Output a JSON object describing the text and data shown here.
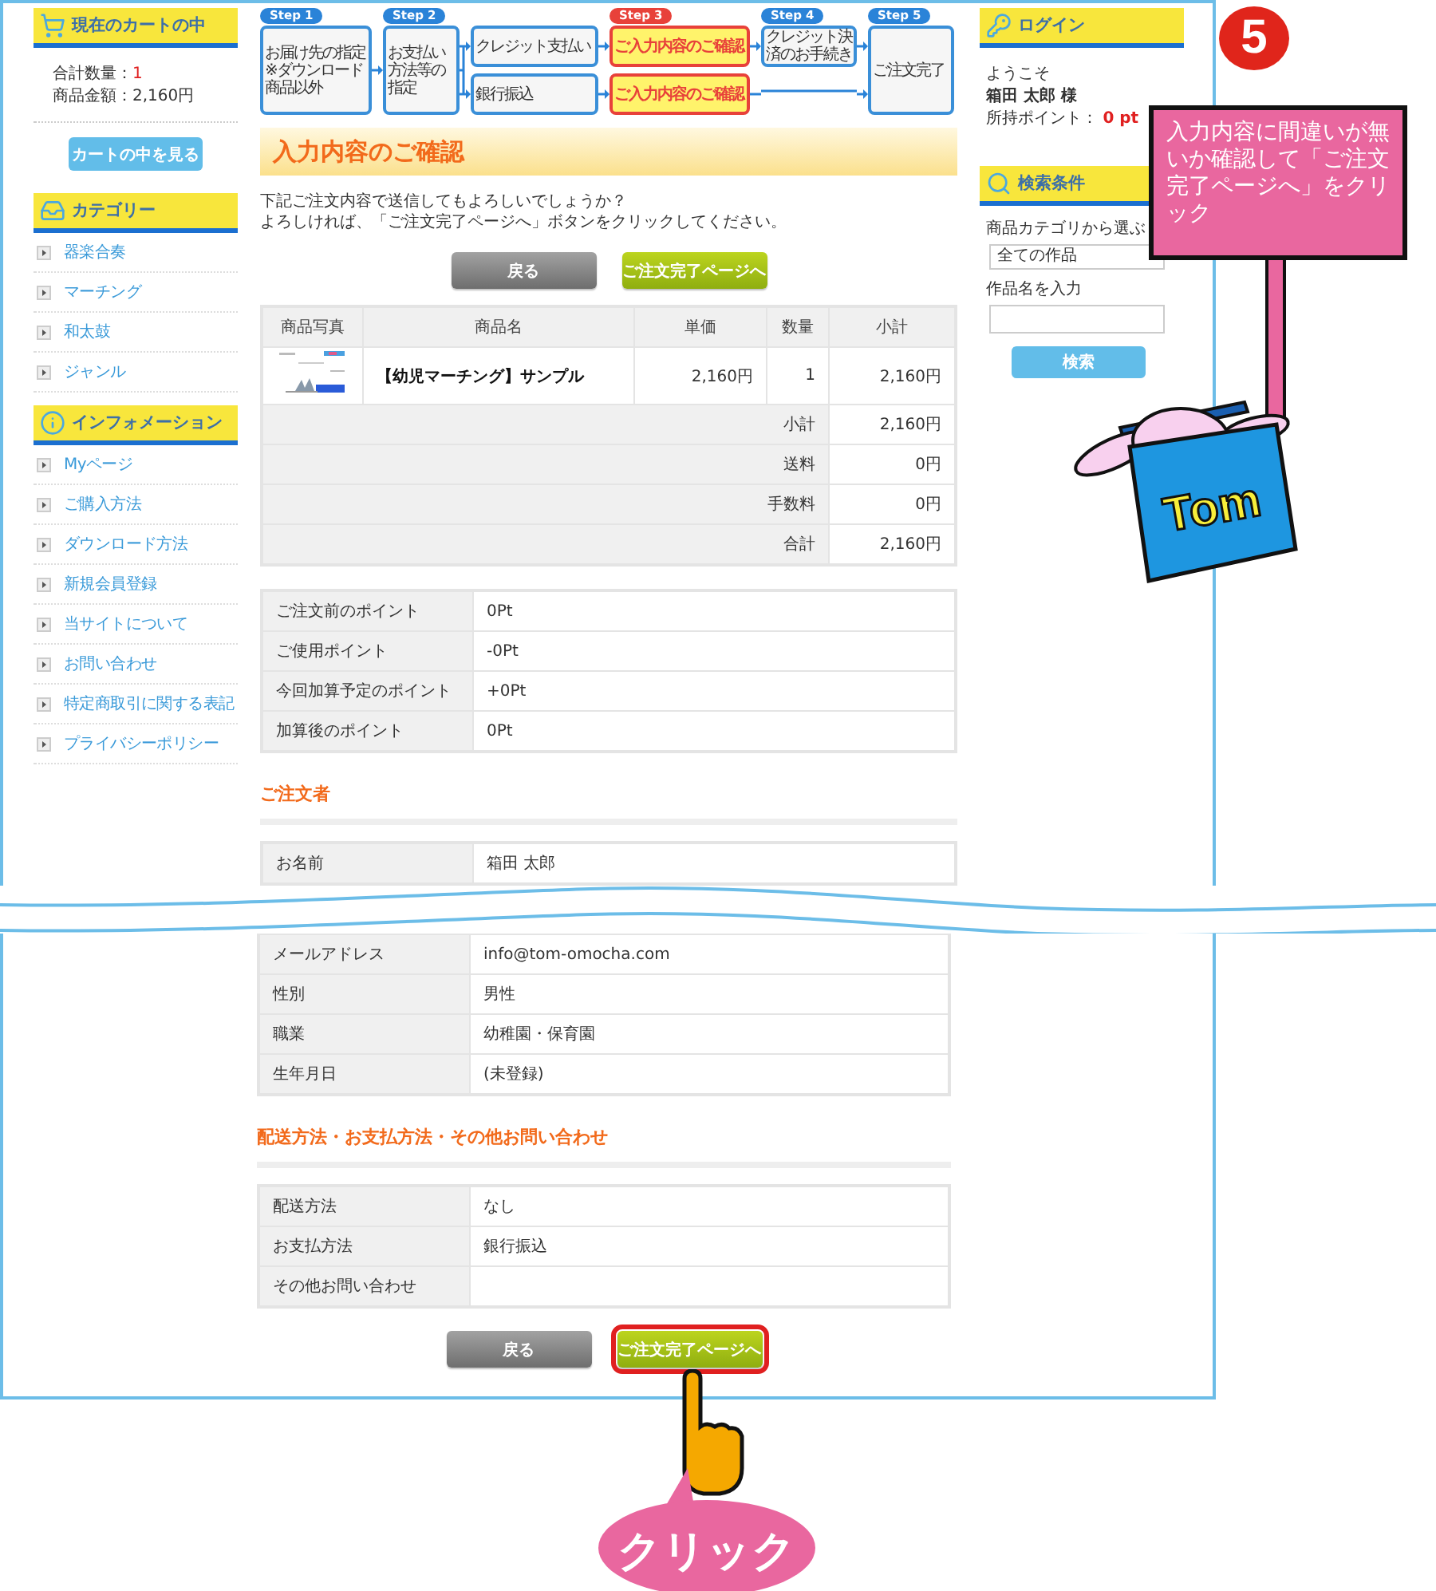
{
  "cart": {
    "title": "現在のカートの中",
    "lines": [
      {
        "label": "合計数量：",
        "value": "1",
        "emphasis": true
      },
      {
        "label": "商品金額：",
        "value": "2,160円",
        "emphasis": false
      }
    ],
    "button": "カートの中を見る"
  },
  "categories": {
    "title": "カテゴリー",
    "items": [
      "器楽合奏",
      "マーチング",
      "和太鼓",
      "ジャンル"
    ]
  },
  "information": {
    "title": "インフォメーション",
    "items": [
      "Myページ",
      "ご購入方法",
      "ダウンロード方法",
      "新規会員登録",
      "当サイトについて",
      "お問い合わせ",
      "特定商取引に関する表記",
      "プライバシーポリシー"
    ]
  },
  "steps": [
    {
      "label": "Step 1",
      "selected": false,
      "bypass": false,
      "options": [
        {
          "text": "お届け先の指定",
          "note": "※ダウンロード商品以外"
        }
      ]
    },
    {
      "label": "Step 2",
      "selected": false,
      "bypass": false,
      "options": [
        {
          "text": "お支払い方法等の指定"
        }
      ]
    },
    {
      "selected": false,
      "bypass": false,
      "options": [
        {
          "text": "クレジット支払い"
        },
        {
          "text": "銀行振込"
        }
      ]
    },
    {
      "label": "Step 3",
      "selected": true,
      "bypass": false,
      "options": [
        {
          "text": "ご入力内容のご確認"
        },
        {
          "text": "ご入力内容のご確認"
        }
      ]
    },
    {
      "label": "Step 4",
      "selected": false,
      "bypass": true,
      "options": [
        {
          "text": "クレジット決済のお手続き"
        }
      ]
    },
    {
      "label": "Step 5",
      "selected": false,
      "bypass": false,
      "options": [
        {
          "text": "ご注文完了"
        }
      ]
    }
  ],
  "page_title": "入力内容のご確認",
  "intro": [
    "下記ご注文内容で送信してもよろしいでしょうか？",
    "よろしければ、「ご注文完了ページへ」ボタンをクリックしてください。"
  ],
  "top_buttons": [
    {
      "label": "戻る",
      "kind": "back",
      "highlighted": false
    },
    {
      "label": "ご注文完了ページへ",
      "kind": "submit",
      "highlighted": false
    }
  ],
  "items_table": {
    "columns": [
      "商品写真",
      "商品名",
      "単価",
      "数量",
      "小計"
    ],
    "rows": [
      {
        "name": "【幼児マーチング】サンプル",
        "price": "2,160円",
        "quantity": "1",
        "subtotal": "2,160円"
      }
    ],
    "summary": [
      {
        "label": "小計",
        "value": "2,160円"
      },
      {
        "label": "送料",
        "value": "0円"
      },
      {
        "label": "手数料",
        "value": "0円"
      },
      {
        "label": "合計",
        "value": "2,160円"
      }
    ]
  },
  "points": [
    {
      "label": "ご注文前のポイント",
      "value": "0Pt"
    },
    {
      "label": "ご使用ポイント",
      "value": "-0Pt"
    },
    {
      "label": "今回加算予定のポイント",
      "value": "+0Pt"
    },
    {
      "label": "加算後のポイント",
      "value": "0Pt"
    }
  ],
  "orderer": {
    "heading": "ご注文者",
    "rows_above_break": [
      {
        "label": "お名前",
        "value": "箱田 太郎"
      }
    ],
    "rows_below_break": [
      {
        "label": "メールアドレス",
        "value": "info@tom-omocha.com"
      },
      {
        "label": "性別",
        "value": "男性"
      },
      {
        "label": "職業",
        "value": "幼稚園・保育園"
      },
      {
        "label": "生年月日",
        "value": "(未登録)"
      }
    ]
  },
  "delivery": {
    "heading": "配送方法・お支払方法・その他お問い合わせ",
    "rows": [
      {
        "label": "配送方法",
        "value": "なし"
      },
      {
        "label": "お支払方法",
        "value": "銀行振込"
      },
      {
        "label": "その他お問い合わせ"
      }
    ]
  },
  "bottom_buttons": [
    {
      "label": "戻る",
      "kind": "back",
      "highlighted": false
    },
    {
      "label": "ご注文完了ページへ",
      "kind": "submit",
      "highlighted": true
    }
  ],
  "login": {
    "title": "ログイン",
    "greeting": "ようこそ",
    "user": "箱田 太郎 様",
    "points_label": "所持ポイント：",
    "points_value": "0 pt"
  },
  "search": {
    "title": "検索条件",
    "category_label": "商品カテゴリから選ぶ",
    "category_value": "全ての作品",
    "name_label": "作品名を入力",
    "button": "検索"
  },
  "annotation": {
    "number": "5",
    "callout": "入力内容に間違いが無いか確認して「ご注文完了ページへ」をクリック",
    "mascot_label": "Tom",
    "click_label": "クリック"
  }
}
